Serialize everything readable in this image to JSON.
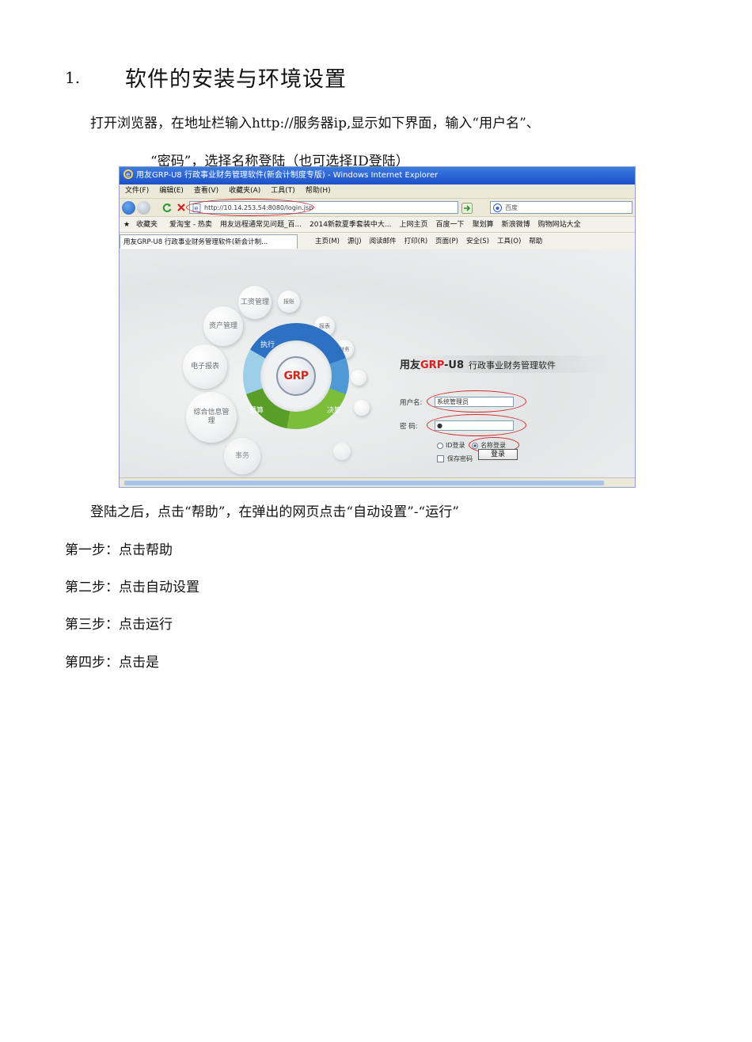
{
  "heading": {
    "number": "1.",
    "title": "软件的安装与环境设置"
  },
  "paragraphs": {
    "intro_line1": "打开浏览器，在地址栏输入http://服务器ip,显示如下界面，输入“用户名”、",
    "intro_line2": "“密码”，选择名称登陆（也可选择ID登陆）",
    "after_login": "登陆之后，点击“帮助”，在弹出的网页点击“自动设置”-“运行”"
  },
  "steps": [
    "第一步：点击帮助",
    "第二步：点击自动设置",
    "第三步：点击运行",
    "第四步：点击是"
  ],
  "browser": {
    "window_title": "用友GRP-U8 行政事业财务管理软件(新会计制度专版) - Windows Internet Explorer",
    "menu": [
      "文件(F)",
      "编辑(E)",
      "查看(V)",
      "收藏夹(A)",
      "工具(T)",
      "帮助(H)"
    ],
    "address": "http://10.14.253.54:8080/login.jsp",
    "search_placeholder": "百度",
    "favorites": [
      "收藏夹",
      "爱淘宝 - 热卖",
      "用友远程通常见问题_百...",
      "2014新款夏季套装中大...",
      "上网主页",
      "百度一下",
      "聚划算",
      "新浪微博",
      "购物网站大全"
    ],
    "tab_title": "用友GRP-U8 行政事业财务管理软件(新会计制...",
    "commands": [
      "主页(M)",
      "源(J)",
      "阅读邮件",
      "打印(R)",
      "页面(P)",
      "安全(S)",
      "工具(O)",
      "帮助"
    ]
  },
  "login_page": {
    "brand_prefix": "用友",
    "brand_grp": "GRP",
    "brand_suffix": "-U8",
    "brand_subtitle": "行政事业财务管理软件",
    "logo_text": "GRP",
    "modules": [
      "工资管理",
      "报账",
      "资产管理",
      "报表",
      "电子报表",
      "综合信息管理",
      "财务",
      "执行",
      "预算",
      "决算",
      "事务"
    ],
    "username_label": "用户名:",
    "username_value": "系统管理员",
    "password_label": "密 码:",
    "password_value": "●",
    "radio_id": "ID登录",
    "radio_name": "名称登录",
    "save_password": "保存密码",
    "login_button": "登录"
  },
  "colors": {
    "ie_blue": "#1c50c8",
    "annotation_red": "#d22a2a",
    "grp_red": "#cf2a1e"
  }
}
